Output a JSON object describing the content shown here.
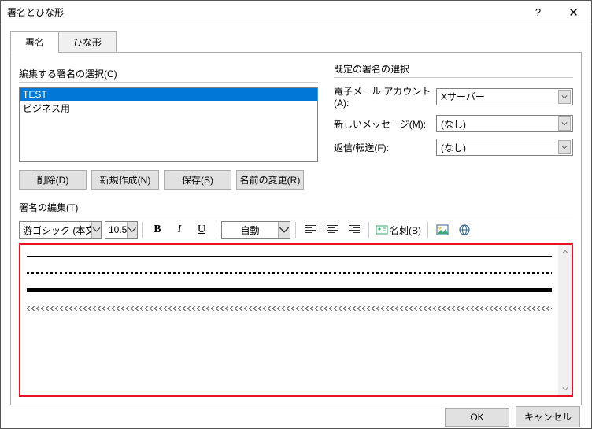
{
  "window": {
    "title": "署名とひな形"
  },
  "tabs": {
    "signature": "署名",
    "template": "ひな形"
  },
  "leftGroup": {
    "legend": "編集する署名の選択(C)",
    "items": [
      "TEST",
      "ビジネス用"
    ],
    "selectedIndex": 0,
    "buttons": {
      "delete": "削除(D)",
      "new": "新規作成(N)",
      "save": "保存(S)",
      "rename": "名前の変更(R)"
    }
  },
  "rightGroup": {
    "legend": "既定の署名の選択",
    "accountLabel": "電子メール アカウント(A):",
    "accountValue": "Xサーバー",
    "newMsgLabel": "新しいメッセージ(M):",
    "newMsgValue": "(なし)",
    "replyLabel": "返信/転送(F):",
    "replyValue": "(なし)"
  },
  "editGroup": {
    "legend": "署名の編集(T)",
    "font": "游ゴシック (本文の",
    "size": "10.5",
    "colorAuto": "自動",
    "bizcard": "名刺(B)"
  },
  "footer": {
    "ok": "OK",
    "cancel": "キャンセル"
  }
}
